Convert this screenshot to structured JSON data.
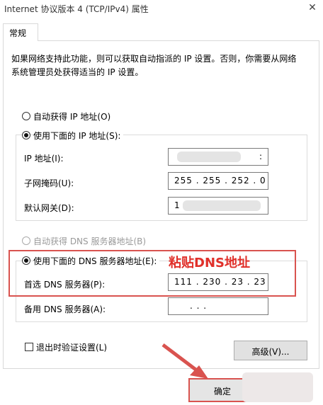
{
  "window": {
    "title": "Internet 协议版本 4 (TCP/IPv4) 属性",
    "close_icon": "close-icon"
  },
  "tabs": [
    {
      "label": "常规"
    }
  ],
  "description": "如果网络支持此功能，则可以获取自动指派的 IP 设置。否则，你需要从网络系统管理员处获得适当的 IP 设置。",
  "ip_section": {
    "auto_label": "自动获得 IP 地址(O)",
    "manual_label": "使用下面的 IP 地址(S):",
    "selected": "manual",
    "fields": [
      {
        "label": "IP 地址(I):",
        "value": ":"
      },
      {
        "label": "子网掩码(U):",
        "value": "255 . 255 . 252 .  0"
      },
      {
        "label": "默认网关(D):",
        "value": "1"
      }
    ]
  },
  "dns_section": {
    "auto_label": "自动获得 DNS 服务器地址(B)",
    "manual_label": "使用下面的 DNS 服务器地址(E):",
    "selected": "manual",
    "fields": [
      {
        "label": "首选 DNS 服务器(P):",
        "value": "111 . 230 .  23  .  23"
      },
      {
        "label": "备用 DNS 服务器(A):",
        "value": ".        .        ."
      }
    ]
  },
  "validate_label": "退出时验证设置(L)",
  "advanced_label": "高级(V)...",
  "ok_label": "确定",
  "annotation": {
    "text": "粘贴DNS地址",
    "color": "#e0302a"
  },
  "colors": {
    "highlight_box": "#d9534f",
    "arrow": "#d9534f"
  }
}
